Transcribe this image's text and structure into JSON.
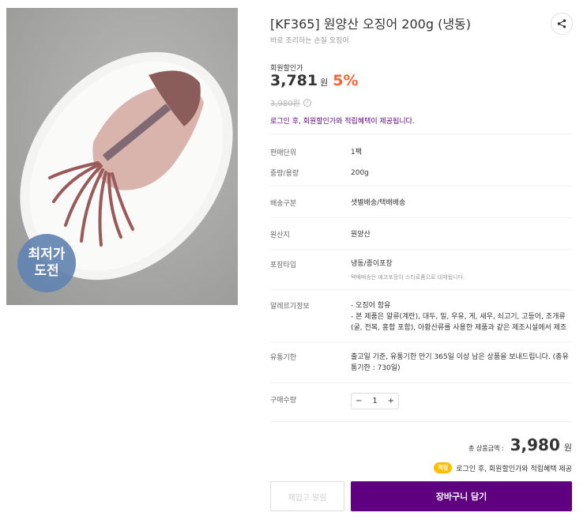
{
  "image": {
    "badge_line1": "최저가",
    "badge_line2": "도전"
  },
  "product": {
    "title": "[KF365] 원양산 오징어 200g (냉동)",
    "subtitle": "바로 조리하는 손질 오징어"
  },
  "share": {
    "icon": "share-icon"
  },
  "price": {
    "member_label": "회원할인가",
    "value": "3,781",
    "unit": "원",
    "discount": "5%",
    "original": "3,980원",
    "help_icon": "?"
  },
  "notice": "로그인 후, 회원할인가와 적립혜택이 제공됩니다.",
  "specs": [
    {
      "label": "판매단위",
      "value": "1팩"
    },
    {
      "label": "중량/용량",
      "value": "200g"
    },
    {
      "label": "배송구분",
      "value": "샛별배송/택배배송"
    },
    {
      "label": "원산지",
      "value": "원양산"
    },
    {
      "label": "포장타입",
      "value": "냉동/종이포장",
      "sub": "택배배송은 에코포장이 스티로폼으로 대체됩니다."
    },
    {
      "label": "알레르기정보",
      "value_line1": "- 오징어 함유",
      "value_line2": "- 본 제품은 알류(계란), 대두, 밀, 우유, 게, 새우, 쇠고기, 고등어, 조개류(굴, 전복, 홍합 포함), 아황산류를 사용한 제품과 같은 제조시설에서 제조"
    },
    {
      "label": "유통기한",
      "value": "출고일 기준, 유통기한 만기 365일 이상 남은 상품을 보내드립니다. (총유통기한 : 730일)"
    },
    {
      "label": "구매수량"
    }
  ],
  "quantity": {
    "minus": "−",
    "value": "1",
    "plus": "+"
  },
  "total": {
    "label": "총 상품금액 :",
    "value": "3,980",
    "unit": "원"
  },
  "accrual": {
    "badge": "적립",
    "text": "로그인 후, 회원할인가와 적립혜택 제공"
  },
  "buttons": {
    "restock": "재입고 알림",
    "cart": "장바구니 담기"
  },
  "colors": {
    "brand": "#5f0080",
    "discount": "#fa622f",
    "badge_blue": "#6284b2",
    "accrual_badge": "#ffbf00"
  }
}
